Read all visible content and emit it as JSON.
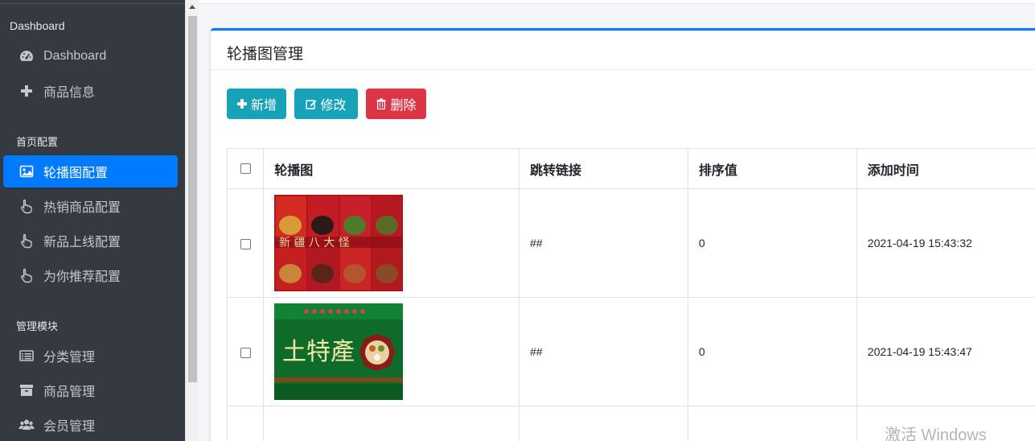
{
  "sidebar": {
    "header1": "Dashboard",
    "items_top": [
      {
        "label": "Dashboard",
        "icon": "tachometer-icon"
      },
      {
        "label": "商品信息",
        "icon": "plus-icon"
      }
    ],
    "header2": "首页配置",
    "items_home": [
      {
        "label": "轮播图配置",
        "icon": "image-icon",
        "active": true
      },
      {
        "label": "热销商品配置",
        "icon": "hand-pointer-icon"
      },
      {
        "label": "新品上线配置",
        "icon": "hand-pointer-icon"
      },
      {
        "label": "为你推荐配置",
        "icon": "hand-pointer-icon"
      }
    ],
    "header3": "管理模块",
    "items_manage": [
      {
        "label": "分类管理",
        "icon": "list-icon"
      },
      {
        "label": "商品管理",
        "icon": "archive-icon"
      },
      {
        "label": "会员管理",
        "icon": "users-icon"
      }
    ]
  },
  "card": {
    "title": "轮播图管理",
    "buttons": {
      "add": "新增",
      "edit": "修改",
      "delete": "删除"
    }
  },
  "table": {
    "headers": [
      "轮播图",
      "跳转链接",
      "排序值",
      "添加时间"
    ],
    "rows": [
      {
        "image": "新疆八大怪 坚果礼盒",
        "link": "##",
        "sort": "0",
        "time": "2021-04-19 15:43:32"
      },
      {
        "image": "土特产 礼盒",
        "link": "##",
        "sort": "0",
        "time": "2021-04-19 15:43:47"
      }
    ]
  },
  "watermark": "激活 Windows",
  "colors": {
    "sidebar": "#343a40",
    "active": "#007bff",
    "info": "#17a2b8",
    "danger": "#dc3545"
  }
}
